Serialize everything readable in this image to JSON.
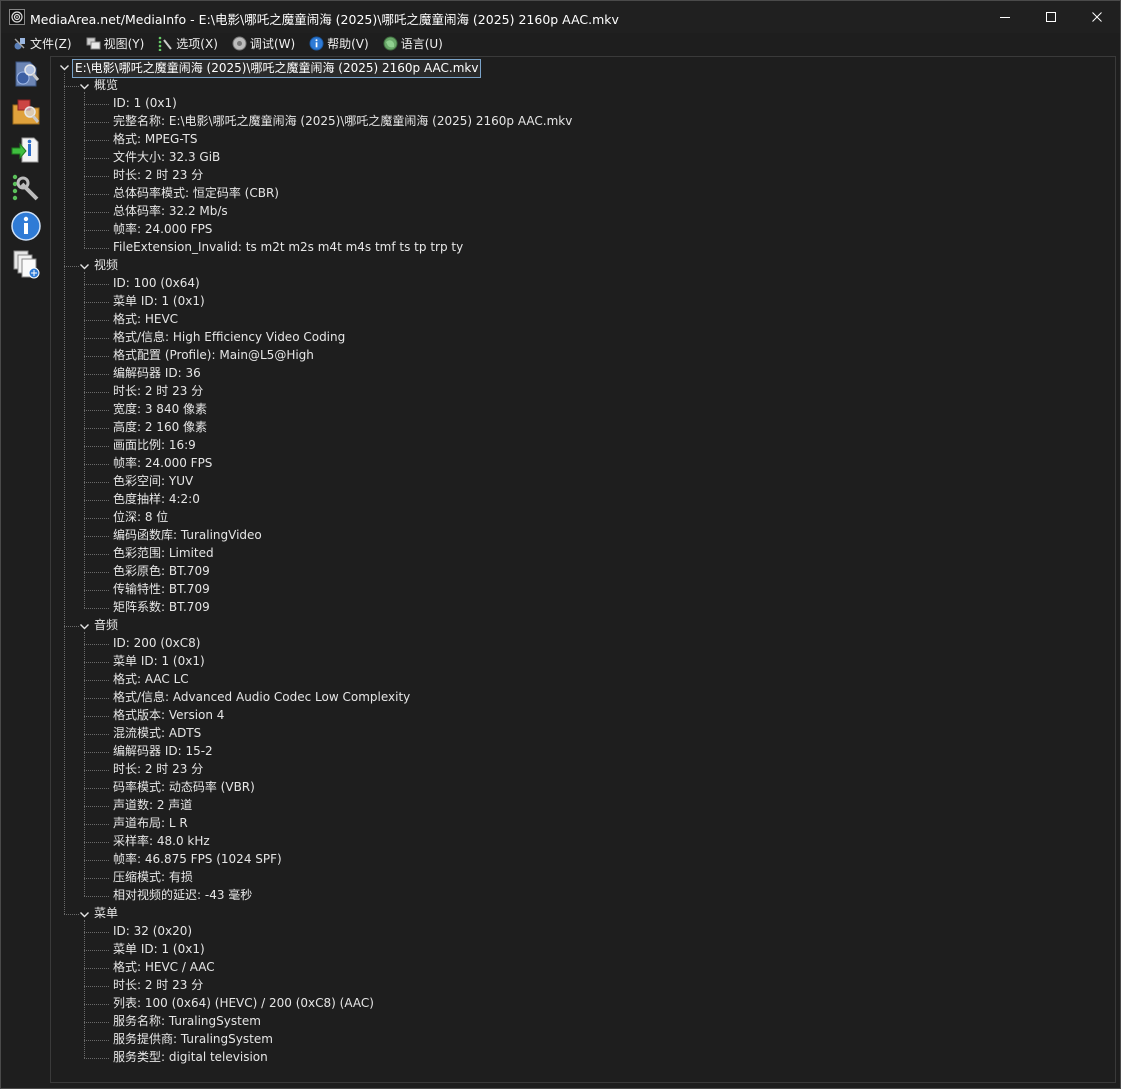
{
  "window": {
    "title": "MediaArea.net/MediaInfo - E:\\电影\\哪吒之魔童闹海 (2025)\\哪吒之魔童闹海 (2025) 2160p AAC.mkv"
  },
  "menu": [
    {
      "label": "文件(Z)",
      "icon": "file-menu-icon"
    },
    {
      "label": "视图(Y)",
      "icon": "view-menu-icon"
    },
    {
      "label": "选项(X)",
      "icon": "options-menu-icon"
    },
    {
      "label": "调试(W)",
      "icon": "debug-menu-icon"
    },
    {
      "label": "帮助(V)",
      "icon": "help-menu-icon"
    },
    {
      "label": "语言(U)",
      "icon": "language-menu-icon"
    }
  ],
  "toolbar": [
    {
      "name": "open-file-icon"
    },
    {
      "name": "open-folder-icon"
    },
    {
      "name": "export-info-icon"
    },
    {
      "name": "preferences-icon"
    },
    {
      "name": "about-icon"
    },
    {
      "name": "knowledge-base-icon"
    }
  ],
  "tree": {
    "root": "E:\\电影\\哪吒之魔童闹海 (2025)\\哪吒之魔童闹海 (2025) 2160p AAC.mkv",
    "sections": [
      {
        "title": "概览",
        "items": [
          "ID: 1 (0x1)",
          "完整名称: E:\\电影\\哪吒之魔童闹海 (2025)\\哪吒之魔童闹海 (2025) 2160p AAC.mkv",
          "格式: MPEG-TS",
          "文件大小: 32.3 GiB",
          "时长: 2 时 23 分",
          "总体码率模式: 恒定码率 (CBR)",
          "总体码率: 32.2 Mb/s",
          "帧率: 24.000 FPS",
          "FileExtension_Invalid: ts m2t m2s m4t m4s tmf ts tp trp ty"
        ]
      },
      {
        "title": "视频",
        "items": [
          "ID: 100 (0x64)",
          "菜单 ID: 1 (0x1)",
          "格式: HEVC",
          "格式/信息: High Efficiency Video Coding",
          "格式配置 (Profile): Main@L5@High",
          "编解码器 ID: 36",
          "时长: 2 时 23 分",
          "宽度: 3 840 像素",
          "高度: 2 160 像素",
          "画面比例: 16:9",
          "帧率: 24.000 FPS",
          "色彩空间: YUV",
          "色度抽样: 4:2:0",
          "位深: 8 位",
          "编码函数库: TuralingVideo",
          "色彩范围: Limited",
          "色彩原色: BT.709",
          "传输特性: BT.709",
          "矩阵系数: BT.709"
        ]
      },
      {
        "title": "音频",
        "items": [
          "ID: 200 (0xC8)",
          "菜单 ID: 1 (0x1)",
          "格式: AAC LC",
          "格式/信息: Advanced Audio Codec Low Complexity",
          "格式版本: Version 4",
          "混流模式: ADTS",
          "编解码器 ID: 15-2",
          "时长: 2 时 23 分",
          "码率模式: 动态码率 (VBR)",
          "声道数: 2 声道",
          "声道布局: L R",
          "采样率: 48.0 kHz",
          "帧率: 46.875 FPS (1024 SPF)",
          "压缩模式: 有损",
          "相对视频的延迟: -43 毫秒"
        ]
      },
      {
        "title": "菜单",
        "items": [
          "ID: 32 (0x20)",
          "菜单 ID: 1 (0x1)",
          "格式: HEVC / AAC",
          "时长: 2 时 23 分",
          "列表: 100 (0x64) (HEVC) / 200 (0xC8) (AAC)",
          "服务名称: TuralingSystem",
          "服务提供商: TuralingSystem",
          "服务类型: digital television"
        ]
      }
    ]
  }
}
